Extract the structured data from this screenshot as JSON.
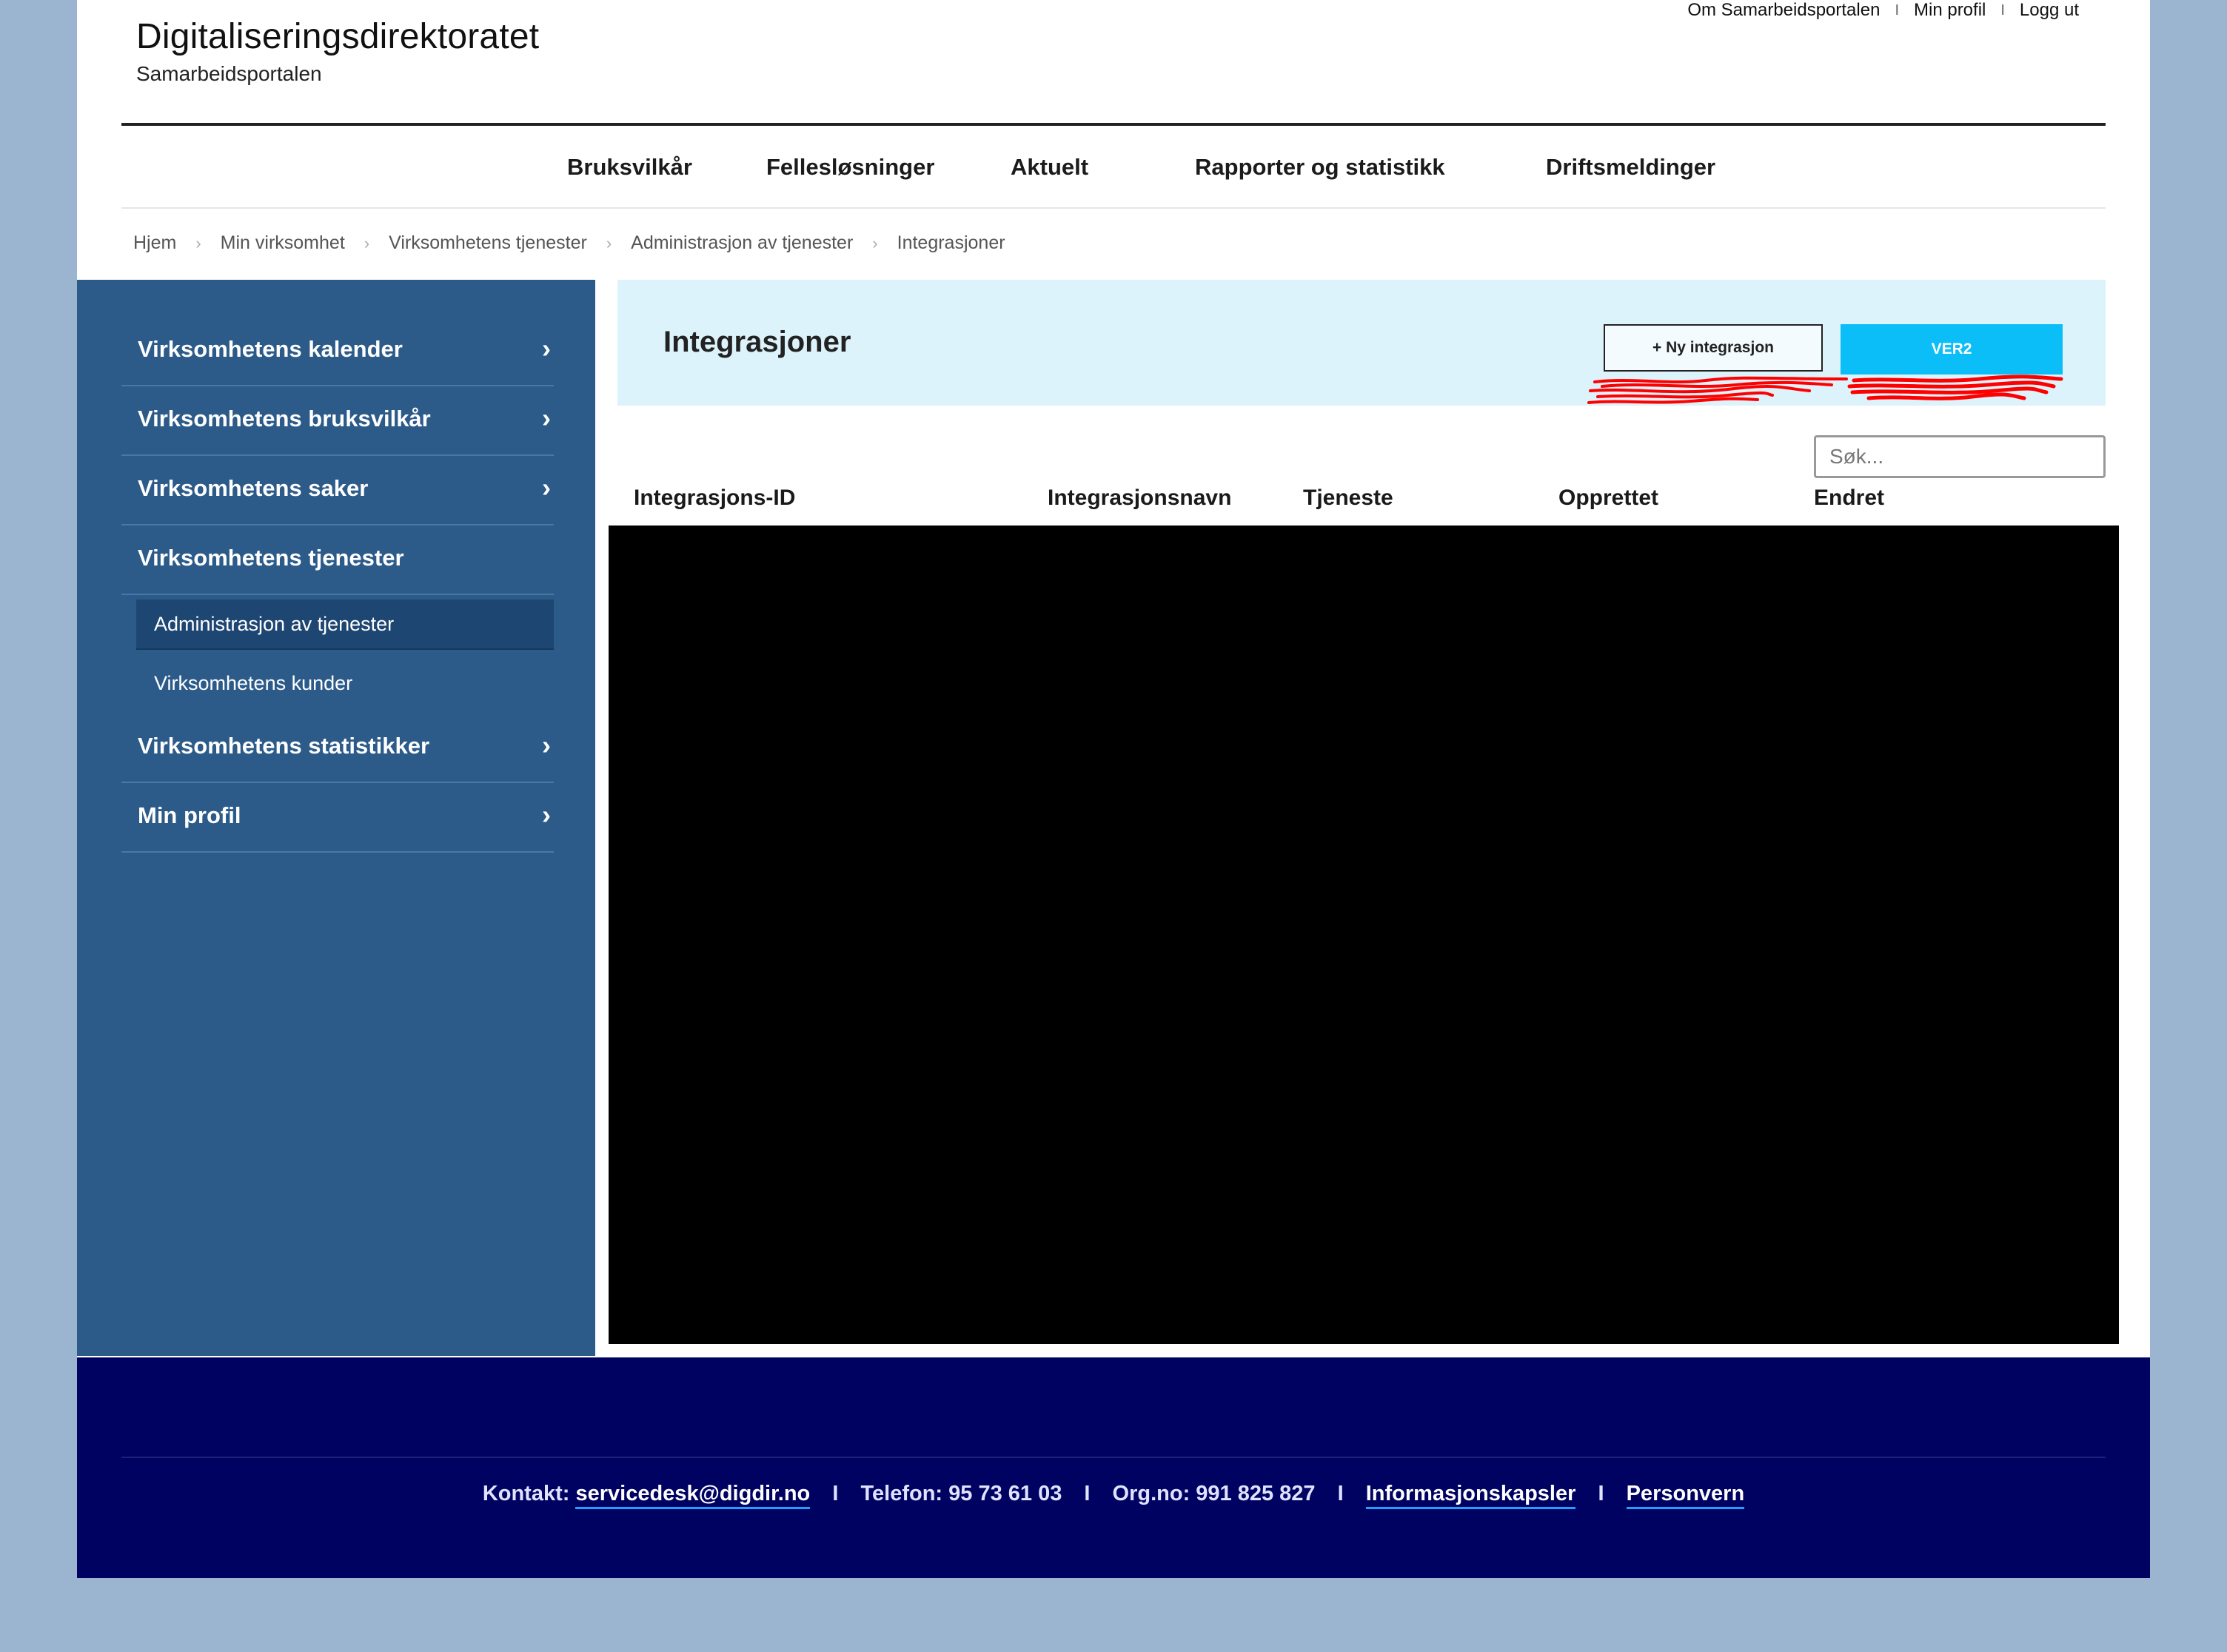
{
  "header": {
    "brand_name": "Digitaliseringsdirektoratet",
    "brand_sub": "Samarbeidsportalen",
    "top_links": [
      "Om Samarbeidsportalen",
      "Min profil",
      "Logg ut"
    ]
  },
  "nav": [
    "Bruksvilkår",
    "Fellesløsninger",
    "Aktuelt",
    "Rapporter og statistikk",
    "Driftsmeldinger"
  ],
  "breadcrumb": [
    "Hjem",
    "Min virksomhet",
    "Virksomhetens tjenester",
    "Administrasjon av tjenester",
    "Integrasjoner"
  ],
  "sidebar": {
    "items": [
      {
        "label": "Virksomhetens kalender",
        "chevron": "›"
      },
      {
        "label": "Virksomhetens bruksvilkår",
        "chevron": "›"
      },
      {
        "label": "Virksomhetens saker",
        "chevron": "›"
      },
      {
        "label": "Virksomhetens tjenester"
      },
      {
        "label": "Virksomhetens statistikker",
        "chevron": "›"
      },
      {
        "label": "Min profil",
        "chevron": "›"
      }
    ],
    "sub_items": [
      {
        "label": "Administrasjon av tjenester",
        "active": true
      },
      {
        "label": "Virksomhetens kunder",
        "active": false
      }
    ]
  },
  "content": {
    "title": "Integrasjoner",
    "new_button": "+ Ny integrasjon",
    "ver2_button": "VER2",
    "search_placeholder": "Søk...",
    "columns": [
      "Integrasjons-ID",
      "Integrasjonsnavn",
      "Tjeneste",
      "Opprettet",
      "Endret"
    ]
  },
  "footer": {
    "contact_label": "Kontakt:",
    "contact_email": "servicedesk@digdir.no",
    "phone": "Telefon: 95 73 61 03",
    "orgno": "Org.no: 991 825 827",
    "cookies": "Informasjonskapsler",
    "privacy": "Personvern",
    "separator": "I"
  },
  "colors": {
    "page_bg": "#9bb5d0",
    "sidebar": "#2c5b8a",
    "content_header": "#dcf3fc",
    "ver2_button": "#0bbef7",
    "footer": "#000262",
    "annotation": "#ff0000"
  }
}
